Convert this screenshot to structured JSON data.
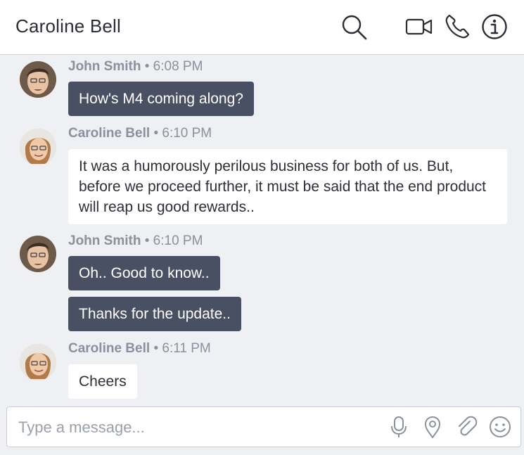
{
  "header": {
    "title": "Caroline Bell",
    "icons": [
      "search-icon",
      "video-call-icon",
      "phone-icon",
      "info-icon"
    ]
  },
  "messages": [
    {
      "sender": "John Smith",
      "time": "6:08 PM",
      "direction": "out",
      "bubbles": [
        "How's M4 coming along?"
      ]
    },
    {
      "sender": "Caroline Bell",
      "time": "6:10 PM",
      "direction": "in",
      "bubbles": [
        "It was a humorously perilous business for both of us. But, before we proceed further, it must be said that the end product will reap us good rewards.."
      ]
    },
    {
      "sender": "John Smith",
      "time": "6:10 PM",
      "direction": "out",
      "bubbles": [
        "Oh.. Good to know..",
        "Thanks for the update.."
      ]
    },
    {
      "sender": "Caroline Bell",
      "time": "6:11 PM",
      "direction": "in",
      "bubbles": [
        "Cheers"
      ]
    }
  ],
  "meta_separator": "•",
  "composer": {
    "placeholder": "Type a message...",
    "value": "",
    "icons": [
      "microphone-icon",
      "location-pin-icon",
      "attachment-icon",
      "emoji-icon"
    ]
  },
  "colors": {
    "outgoing_bubble": "#4a5064",
    "incoming_bubble": "#ffffff",
    "background": "#eef0f4",
    "meta_text": "#8a919c"
  }
}
